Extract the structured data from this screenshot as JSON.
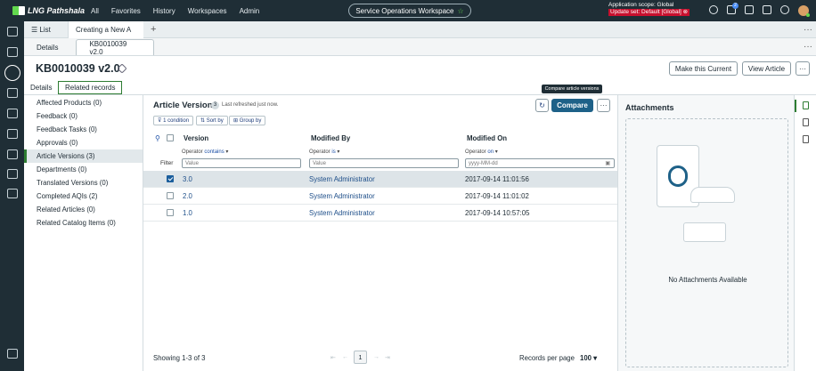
{
  "nav": {
    "logo": "LNG Pathshala",
    "menu": [
      "All",
      "Favorites",
      "History",
      "Workspaces",
      "Admin"
    ],
    "workspace": "Service Operations Workspace",
    "scope_line": "Application scope: Global",
    "update_set": "Update set: Default [Global]",
    "notification_badge": "2"
  },
  "tabs": {
    "list_label": "List",
    "active_label": "Creating a New A",
    "plus": "+",
    "more": "···"
  },
  "subtabs": {
    "details": "Details",
    "record": "KB0010039 v2.0"
  },
  "record": {
    "title": "KB0010039 v2.0",
    "make_current": "Make this Current",
    "view_article": "View Article",
    "more": "···",
    "tab_details": "Details",
    "tab_related": "Related records"
  },
  "related": [
    "Affected Products (0)",
    "Feedback (0)",
    "Feedback Tasks (0)",
    "Approvals (0)",
    "Article Versions (3)",
    "Departments (0)",
    "Translated Versions (0)",
    "Completed AQIs (2)",
    "Related Articles (0)",
    "Related Catalog Items (0)"
  ],
  "list": {
    "title": "Article Versions",
    "count": "3",
    "refreshed": "Last refreshed just now.",
    "chip_condition": "1 condition",
    "chip_sort": "Sort by",
    "chip_group": "Group by",
    "compare": "Compare",
    "tooltip": "Compare article versions",
    "filter_label": "Filter",
    "operator_label": "Operator",
    "columns": [
      {
        "name": "Version",
        "op": "contains",
        "placeholder": "Value"
      },
      {
        "name": "Modified By",
        "op": "is",
        "placeholder": "Value"
      },
      {
        "name": "Modified On",
        "op": "on",
        "placeholder": "yyyy-MM-dd"
      }
    ],
    "rows": [
      {
        "version": "3.0",
        "by": "System Administrator",
        "on": "2017-09-14 11:01:56",
        "selected": true
      },
      {
        "version": "2.0",
        "by": "System Administrator",
        "on": "2017-09-14 11:01:02",
        "selected": false
      },
      {
        "version": "1.0",
        "by": "System Administrator",
        "on": "2017-09-14 10:57:05",
        "selected": false
      }
    ],
    "showing": "Showing 1-3 of 3",
    "page": "1",
    "records_per_page_label": "Records per page",
    "records_per_page": "100"
  },
  "attachments": {
    "title": "Attachments",
    "empty": "No Attachments Available"
  }
}
